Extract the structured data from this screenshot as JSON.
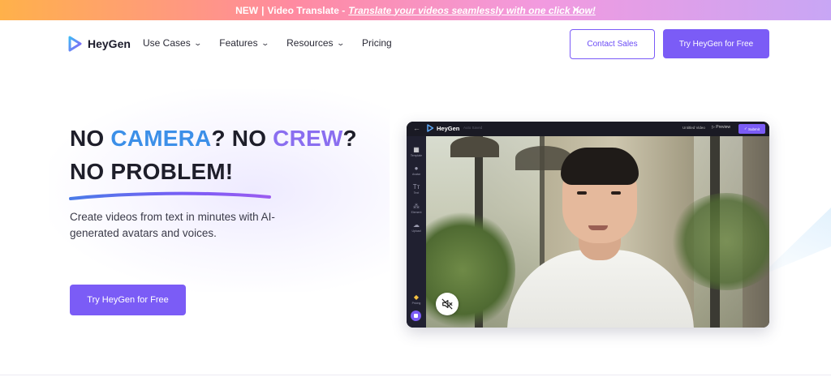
{
  "banner": {
    "prefix": "NEW",
    "separator": "|",
    "label": "Video Translate -",
    "link_text": "Translate your videos seamlessly with one click now!",
    "close_icon": "close-icon"
  },
  "nav": {
    "brand": "HeyGen",
    "links": [
      {
        "label": "Use Cases",
        "has_dropdown": true
      },
      {
        "label": "Features",
        "has_dropdown": true
      },
      {
        "label": "Resources",
        "has_dropdown": true
      },
      {
        "label": "Pricing",
        "has_dropdown": false
      }
    ],
    "contact_label": "Contact Sales",
    "cta_label": "Try HeyGen for Free"
  },
  "hero": {
    "line1_part1": "NO ",
    "line1_highlight1": "CAMERA",
    "line1_part2": "? NO ",
    "line1_highlight2": "CREW",
    "line1_part3": "?",
    "line2": "NO PROBLEM!",
    "subtext": "Create videos from text in minutes with AI-generated avatars and voices.",
    "cta_label": "Try HeyGen for Free"
  },
  "mockup": {
    "brand": "HeyGen",
    "status": "Auto Saved",
    "video_title": "Untitled Video",
    "preview_label": "Preview",
    "submit_label": "Submit",
    "sidebar": [
      {
        "label": "Template",
        "icon": "template-icon"
      },
      {
        "label": "Avatar",
        "icon": "avatar-icon"
      },
      {
        "label": "Text",
        "icon": "text-icon"
      },
      {
        "label": "Element",
        "icon": "element-icon"
      },
      {
        "label": "Upload",
        "icon": "upload-icon"
      },
      {
        "label": "Pricing",
        "icon": "pricing-icon"
      }
    ],
    "mute_icon": "muted-speaker-icon"
  },
  "colors": {
    "accent": "#7b5cf6",
    "camera": "#3c8fe8",
    "crew": "#8a6ef0"
  }
}
